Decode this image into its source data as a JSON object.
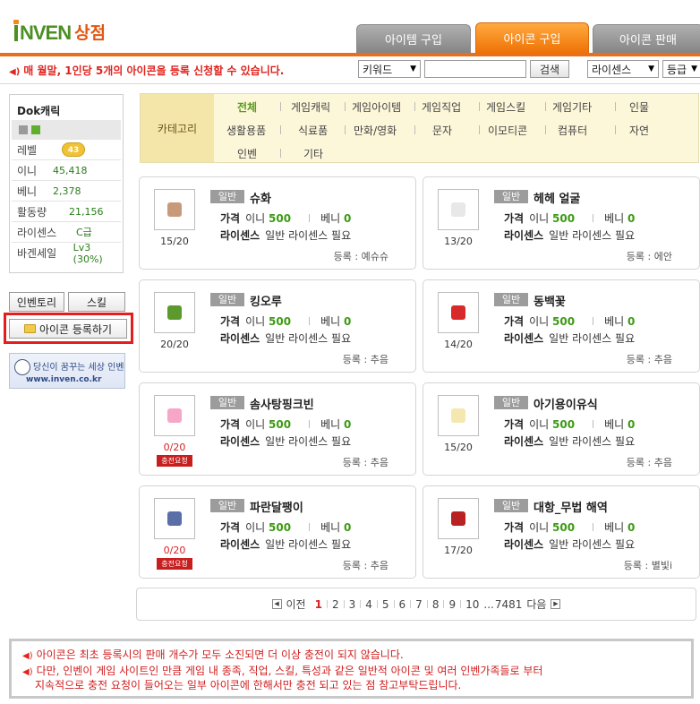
{
  "logo": {
    "brand": "NVEN",
    "suffix": "상점"
  },
  "tabs": [
    {
      "label": "아이템 구입",
      "active": false
    },
    {
      "label": "아이콘 구입",
      "active": true
    },
    {
      "label": "아이콘 판매",
      "active": false
    }
  ],
  "notice": "매 월말, 1인당 5개의 아이콘을 등록 신청할 수 있습니다.",
  "search": {
    "keyword_select": "키워드",
    "input_value": "",
    "button": "검색",
    "license_select": "라이센스",
    "grade_select": "등급"
  },
  "profile": {
    "name": "Dok캐릭",
    "level_label": "레벨",
    "level_value": "43",
    "stats": [
      {
        "key": "이니",
        "value": "45,418"
      },
      {
        "key": "베니",
        "value": "2,378"
      },
      {
        "key": "활동량",
        "value": "21,156"
      },
      {
        "key": "라이센스",
        "value": "C급"
      },
      {
        "key": "바겐세일",
        "value": "Lv3 (30%)"
      }
    ]
  },
  "sidebar": {
    "inventory_btn": "인벤토리",
    "skill_btn": "스킬",
    "register_btn": "아이콘 등록하기",
    "banner_line1": "당신이 꿈꾸는 세상 인벤",
    "banner_line2": "www.inven.co.kr"
  },
  "category": {
    "label": "카테고리",
    "rows": [
      [
        "전체",
        "게임캐릭",
        "게임아이템",
        "게임직업",
        "게임스킬",
        "게임기타",
        "인물"
      ],
      [
        "생활용품",
        "식료품",
        "만화/영화",
        "문자",
        "이모티콘",
        "컴퓨터",
        "자연"
      ],
      [
        "인벤",
        "기타"
      ]
    ]
  },
  "labels": {
    "price": "가격",
    "inni": "이니",
    "benni": "베니",
    "license": "라이센스",
    "license_need": "일반 라이센스 필요",
    "reg_prefix": "등록 : ",
    "charge_request": "충전요청"
  },
  "cards": [
    {
      "badge": "일반",
      "title": "슈화",
      "inni": "500",
      "benni": "0",
      "count": "15/20",
      "soldout": false,
      "reg": "예슈슈",
      "color": "#c79a7a"
    },
    {
      "badge": "일반",
      "title": "헤헤 얼굴",
      "inni": "500",
      "benni": "0",
      "count": "13/20",
      "soldout": false,
      "reg": "에안",
      "color": "#e8e8e8"
    },
    {
      "badge": "일반",
      "title": "킹오루",
      "inni": "500",
      "benni": "0",
      "count": "20/20",
      "soldout": false,
      "reg": "추음",
      "color": "#5d9a2e"
    },
    {
      "badge": "일반",
      "title": "동백꽃",
      "inni": "500",
      "benni": "0",
      "count": "14/20",
      "soldout": false,
      "reg": "추음",
      "color": "#d82a2a"
    },
    {
      "badge": "일반",
      "title": "솜사탕핑크빈",
      "inni": "500",
      "benni": "0",
      "count": "0/20",
      "soldout": true,
      "reg": "추음",
      "color": "#f6a6c6"
    },
    {
      "badge": "일반",
      "title": "아기용이유식",
      "inni": "500",
      "benni": "0",
      "count": "15/20",
      "soldout": false,
      "reg": "추음",
      "color": "#f4e8b0"
    },
    {
      "badge": "일반",
      "title": "파란달팽이",
      "inni": "500",
      "benni": "0",
      "count": "0/20",
      "soldout": true,
      "reg": "추음",
      "color": "#5a6ea8"
    },
    {
      "badge": "일반",
      "title": "대항_무법 해역",
      "inni": "500",
      "benni": "0",
      "count": "17/20",
      "soldout": false,
      "reg": "별빛i",
      "color": "#b82222"
    }
  ],
  "pager": {
    "prev": "이전",
    "pages": [
      "1",
      "2",
      "3",
      "4",
      "5",
      "6",
      "7",
      "8",
      "9",
      "10"
    ],
    "current": "1",
    "ellipsis": "...",
    "last": "7481",
    "next": "다음"
  },
  "bottom_notice": [
    "아이콘은 최초 등록시의 판매 개수가 모두 소진되면 더 이상 충전이 되지 않습니다.",
    "다만, 인벤이 게임 사이트인 만큼 게임 내 종족, 직업, 스킬, 특성과 같은 일반적 아이콘 및 여러 인벤가족들로 부터",
    "지속적으로 충전 요청이 들어오는 일부 아이콘에 한해서만 충전 되고 있는 점 참고부탁드립니다."
  ]
}
